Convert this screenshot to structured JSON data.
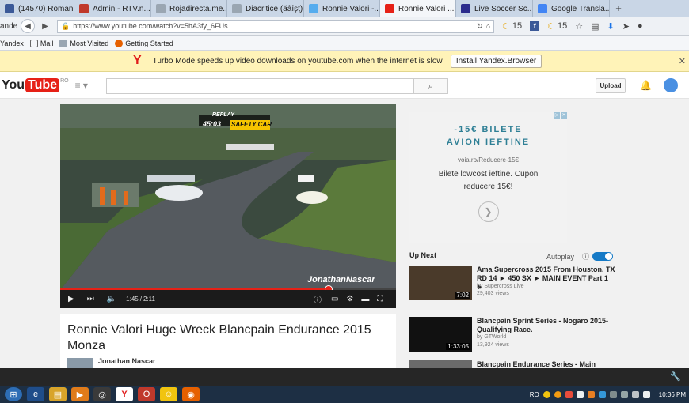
{
  "tabs": [
    {
      "label": "(14570) Roman...",
      "icon": "facebook-icon",
      "color": "#3b5998",
      "active": false
    },
    {
      "label": "Admin - RTV.n...",
      "icon": "rtv-icon",
      "color": "#c0392b",
      "active": false
    },
    {
      "label": "Rojadirecta.me...",
      "icon": "page-icon",
      "color": "#9aa6b2",
      "active": false
    },
    {
      "label": "Diacritice (ăâîșț) - t...",
      "icon": "page-icon",
      "color": "#9aa6b2",
      "active": false
    },
    {
      "label": "Ronnie Valori -...",
      "icon": "twitter-icon",
      "color": "#55acee",
      "active": false
    },
    {
      "label": "Ronnie Valori ...",
      "icon": "youtube-icon",
      "color": "#e62117",
      "active": true
    },
    {
      "label": "Live Soccer Sc...",
      "icon": "livescore-icon",
      "color": "#2b2b8c",
      "active": false
    },
    {
      "label": "Google Transla...",
      "icon": "translate-icon",
      "color": "#4285f4",
      "active": false
    }
  ],
  "browser": {
    "brand": "andex",
    "url": "https://www.youtube.com/watch?v=5hA3fy_6FUs",
    "weather_count_1": "15",
    "weather_count_2": "15"
  },
  "bookmarks": [
    "Yandex",
    "Mail",
    "Most Visited",
    "Getting Started"
  ],
  "banner": {
    "message": "Turbo Mode speeds up video downloads on youtube.com when the internet is slow.",
    "install_label": "Install Yandex.Browser"
  },
  "youtube": {
    "logo_you": "You",
    "logo_tube": "Tube",
    "country": "RO",
    "upload_label": "Upload"
  },
  "player": {
    "replay_label": "REPLAY",
    "race_time": "45:03",
    "safety_car": "SAFETY CAR",
    "watermark": "JonathanNascar",
    "time_current": "1:45",
    "time_total": "2:11",
    "progress": 0.8
  },
  "video": {
    "title": "Ronnie Valori Huge Wreck Blancpain Endurance 2015 Monza",
    "channel": "Jonathan Nascar"
  },
  "ad": {
    "headline_1": "-15€ BILETE",
    "headline_2": "AVION IEFTINE",
    "site": "voia.ro/Reducere-15€",
    "body_1": "Bilete lowcost ieftine. Cupon",
    "body_2": "reducere 15€!"
  },
  "upnext": {
    "label": "Up Next",
    "autoplay_label": "Autoplay",
    "items": [
      {
        "title": "Ama Supercross 2015 From Houston, TX RD 14 ► 450 SX ► MAIN EVENT Part 1 ►",
        "channel": "by Supercross Live",
        "views": "29,403 views",
        "duration": "7:02"
      },
      {
        "title": "Blancpain Sprint Series - Nogaro 2015- Qualifying Race.",
        "channel": "by GTWorld",
        "views": "13,924 views",
        "duration": "1:33:05"
      },
      {
        "title": "Blancpain Endurance Series - Main",
        "channel": "",
        "views": "",
        "duration": ""
      }
    ]
  },
  "taskbar": {
    "lang": "RO",
    "clock": "10:36 PM"
  }
}
